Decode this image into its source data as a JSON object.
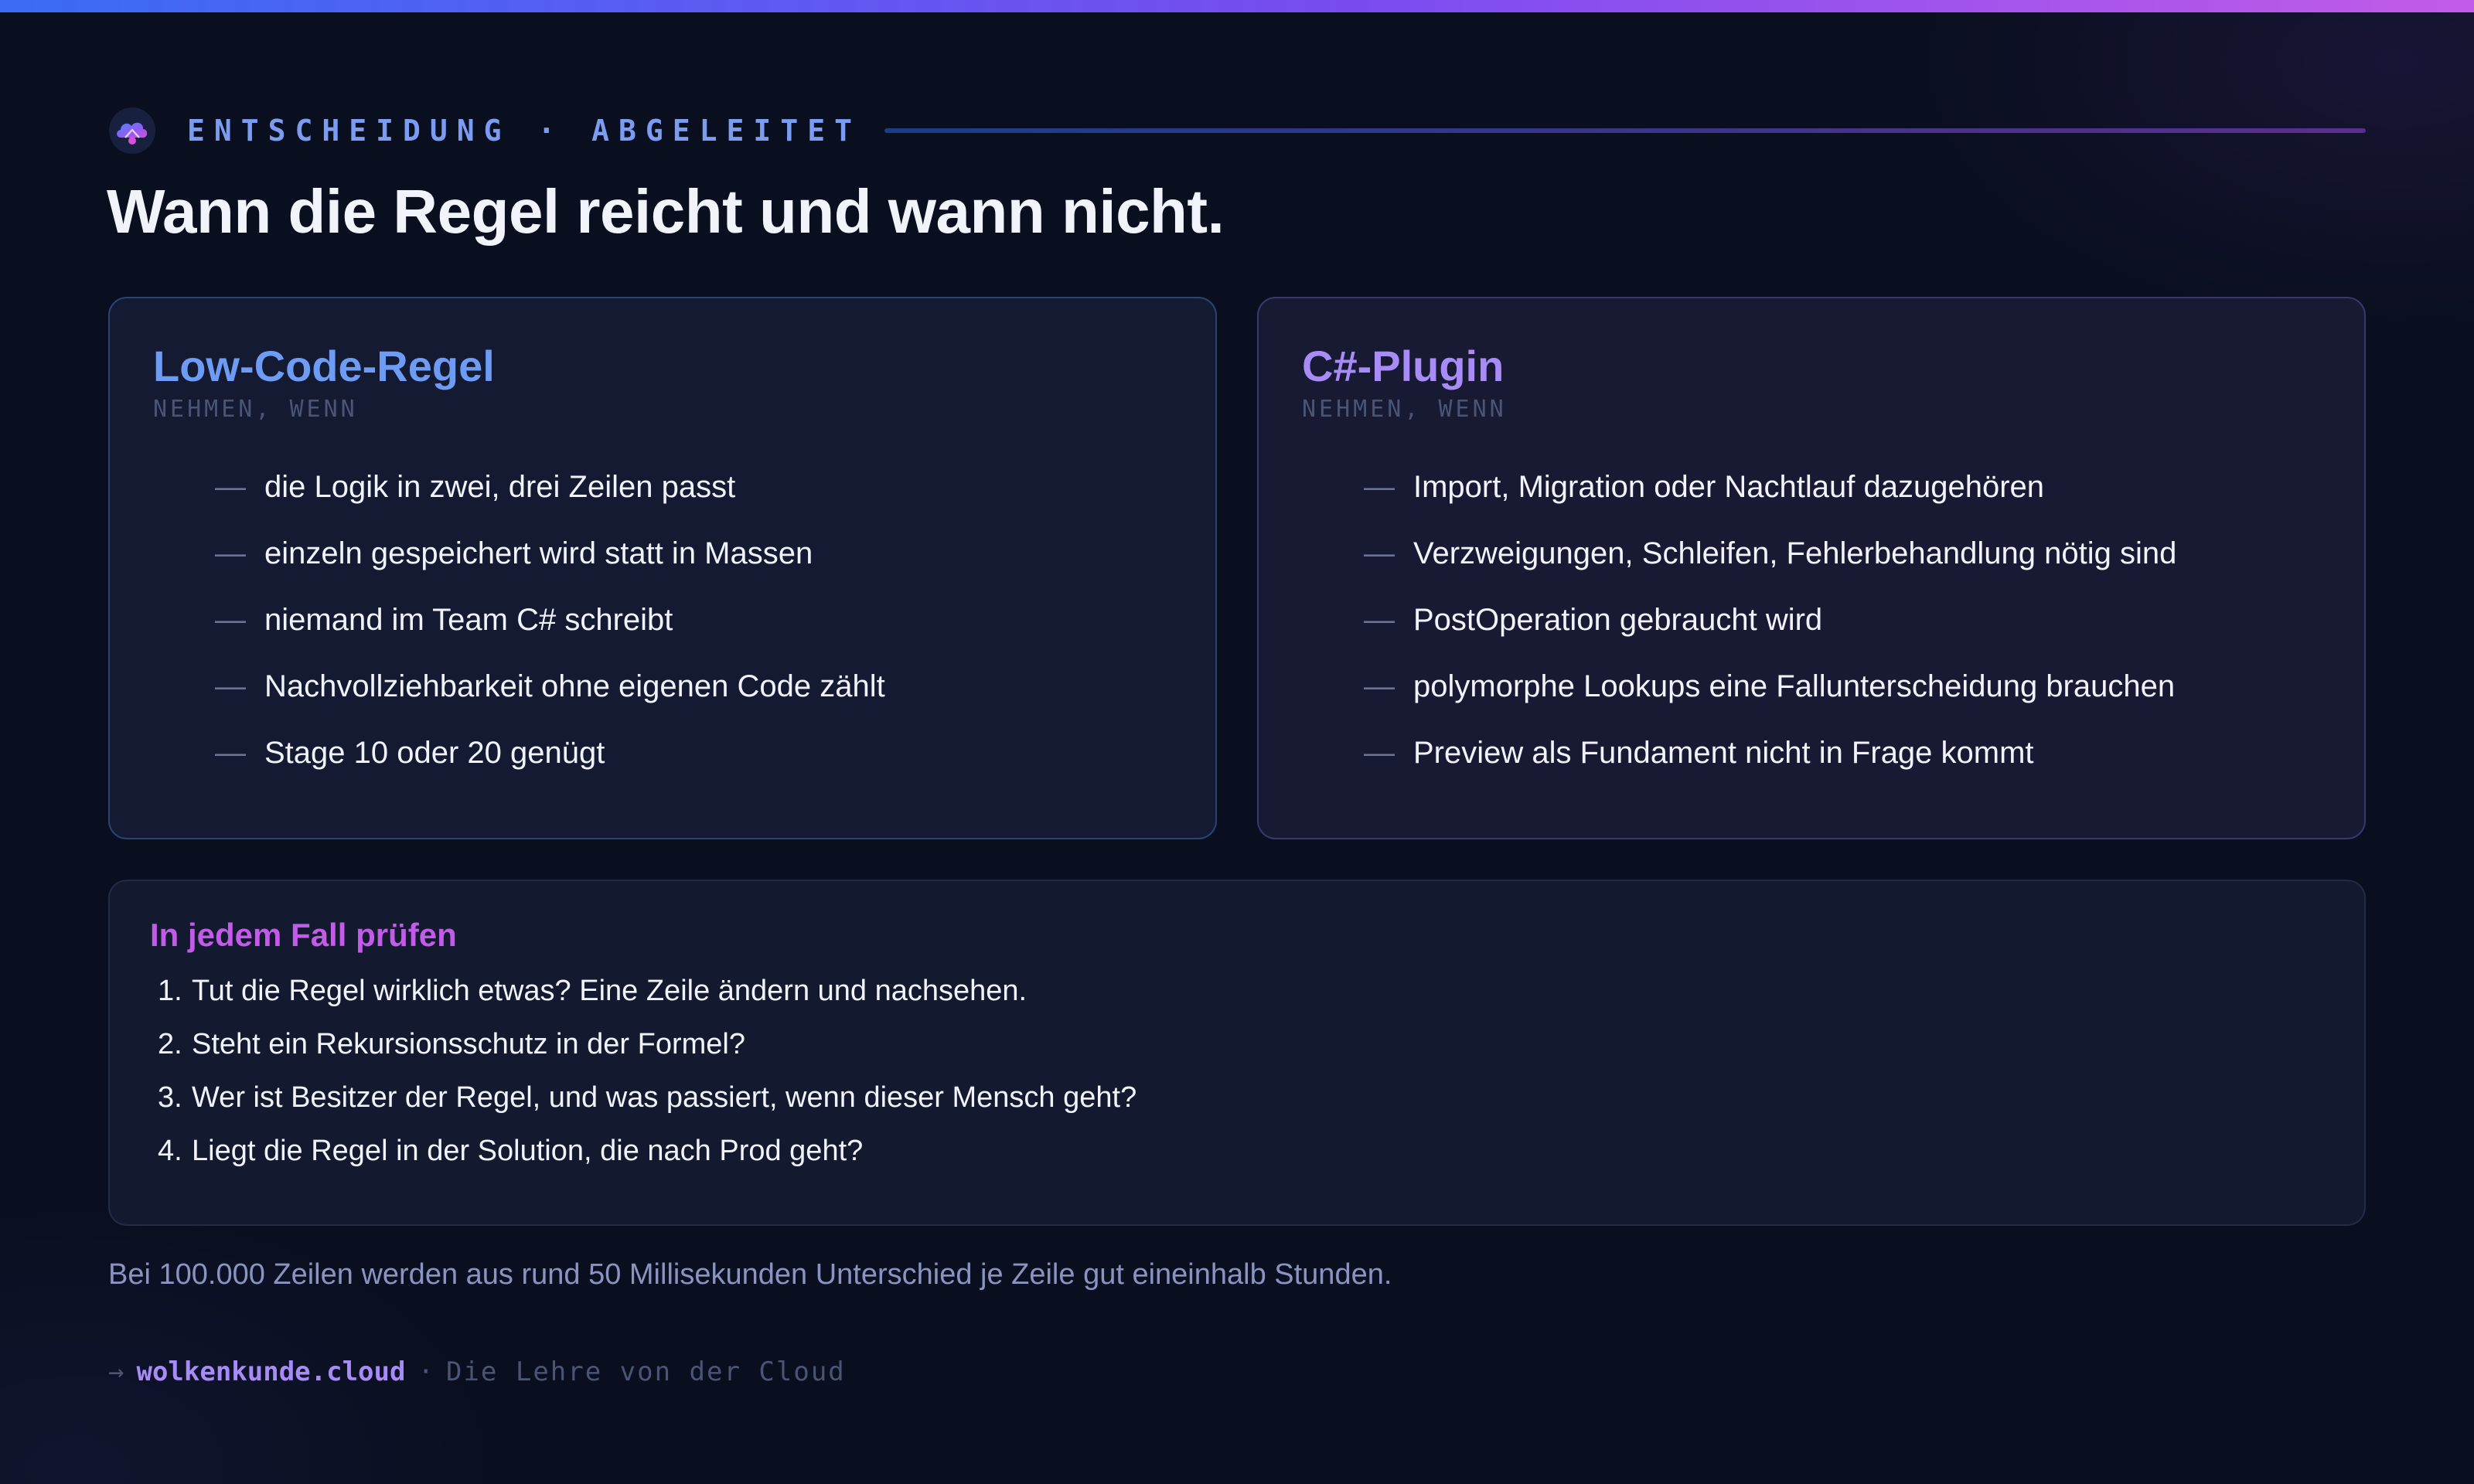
{
  "colors": {
    "background": "#0a0f1f",
    "accent_blue": "#6e9bf4",
    "accent_violet": "#a78bf6",
    "accent_magenta": "#c25be8"
  },
  "header": {
    "logo_icon": "cloud-logo-icon",
    "eyebrow": "ENTSCHEIDUNG · ABGELEITET",
    "title": "Wann die Regel reicht und wann nicht."
  },
  "cards": {
    "left": {
      "title": "Low-Code-Regel",
      "subtitle": "NEHMEN, WENN",
      "bullet_marker": "—",
      "items": [
        "die Logik in zwei, drei Zeilen passt",
        "einzeln gespeichert wird statt in Massen",
        "niemand im Team C# schreibt",
        "Nachvollziehbarkeit ohne eigenen Code zählt",
        "Stage 10 oder 20 genügt"
      ]
    },
    "right": {
      "title": "C#-Plugin",
      "subtitle": "NEHMEN, WENN",
      "bullet_marker": "—",
      "items": [
        "Import, Migration oder Nachtlauf dazugehören",
        "Verzweigungen, Schleifen, Fehlerbehandlung nötig sind",
        "PostOperation gebraucht wird",
        "polymorphe Lookups eine Fallunterscheidung brauchen",
        "Preview als Fundament nicht in Frage kommt"
      ]
    }
  },
  "checks": {
    "title": "In jedem Fall prüfen",
    "items": [
      {
        "num": "1.",
        "text": "Tut die Regel wirklich etwas? Eine Zeile ändern und nachsehen."
      },
      {
        "num": "2.",
        "text": "Steht ein Rekursionsschutz in der Formel?"
      },
      {
        "num": "3.",
        "text": "Wer ist Besitzer der Regel, und was passiert, wenn dieser Mensch geht?"
      },
      {
        "num": "4.",
        "text": "Liegt die Regel in der Solution, die nach Prod geht?"
      }
    ]
  },
  "footnote": "Bei 100.000 Zeilen werden aus rund 50 Millisekunden Unterschied je Zeile gut eineinhalb Stunden.",
  "footer": {
    "arrow": "→",
    "site": "wolkenkunde.cloud",
    "separator": "·",
    "tagline": "Die Lehre von der Cloud"
  }
}
